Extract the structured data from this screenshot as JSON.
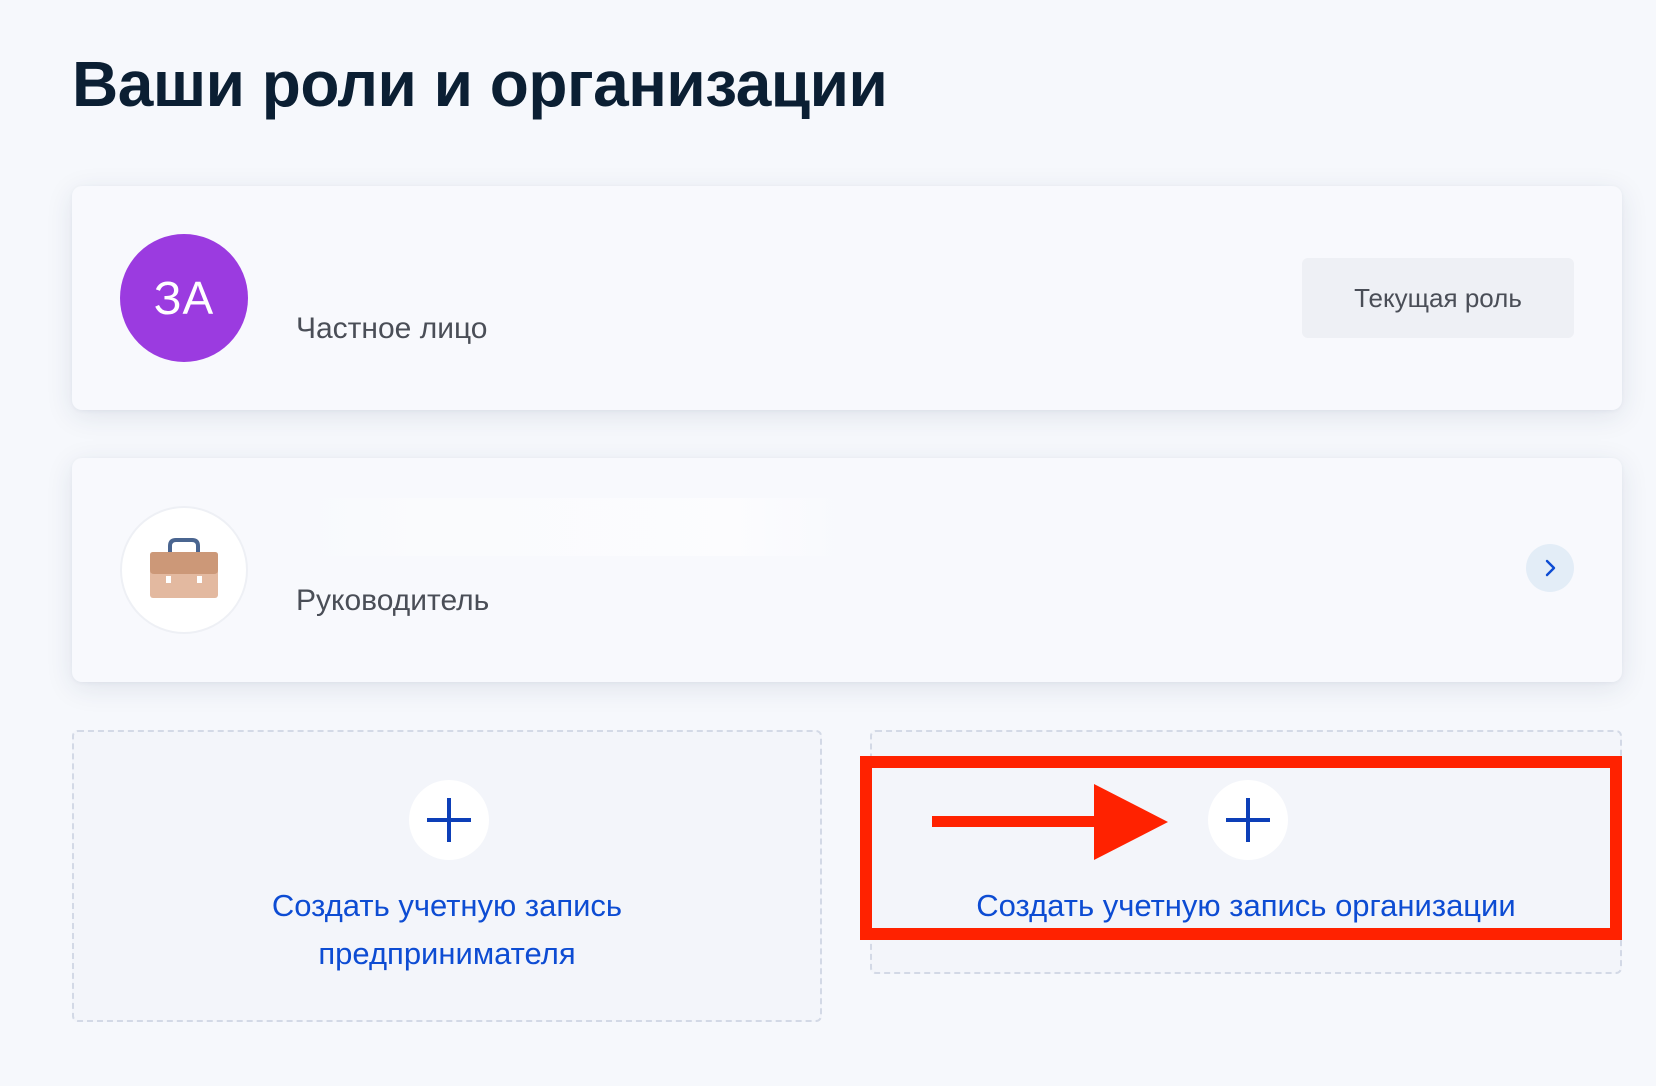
{
  "page": {
    "title": "Ваши роли и организации"
  },
  "roles": [
    {
      "avatar_initials": "ЗА",
      "avatar_color": "#9b3be0",
      "label": "Частное лицо",
      "badge": "Текущая роль"
    },
    {
      "avatar_icon": "briefcase-icon",
      "label": "Руководитель",
      "action_icon": "chevron-right-icon"
    }
  ],
  "create_actions": {
    "entrepreneur": {
      "icon": "plus-icon",
      "label_line1": "Создать учетную запись",
      "label_line2": "предпринимателя"
    },
    "organization": {
      "icon": "plus-icon",
      "label": "Создать учетную запись организации"
    }
  },
  "annotation": {
    "color": "#ff2200",
    "shape": "highlight-box-with-arrow"
  },
  "colors": {
    "title": "#0b1f33",
    "link": "#0d4cd3",
    "background": "#f6f8fc"
  }
}
